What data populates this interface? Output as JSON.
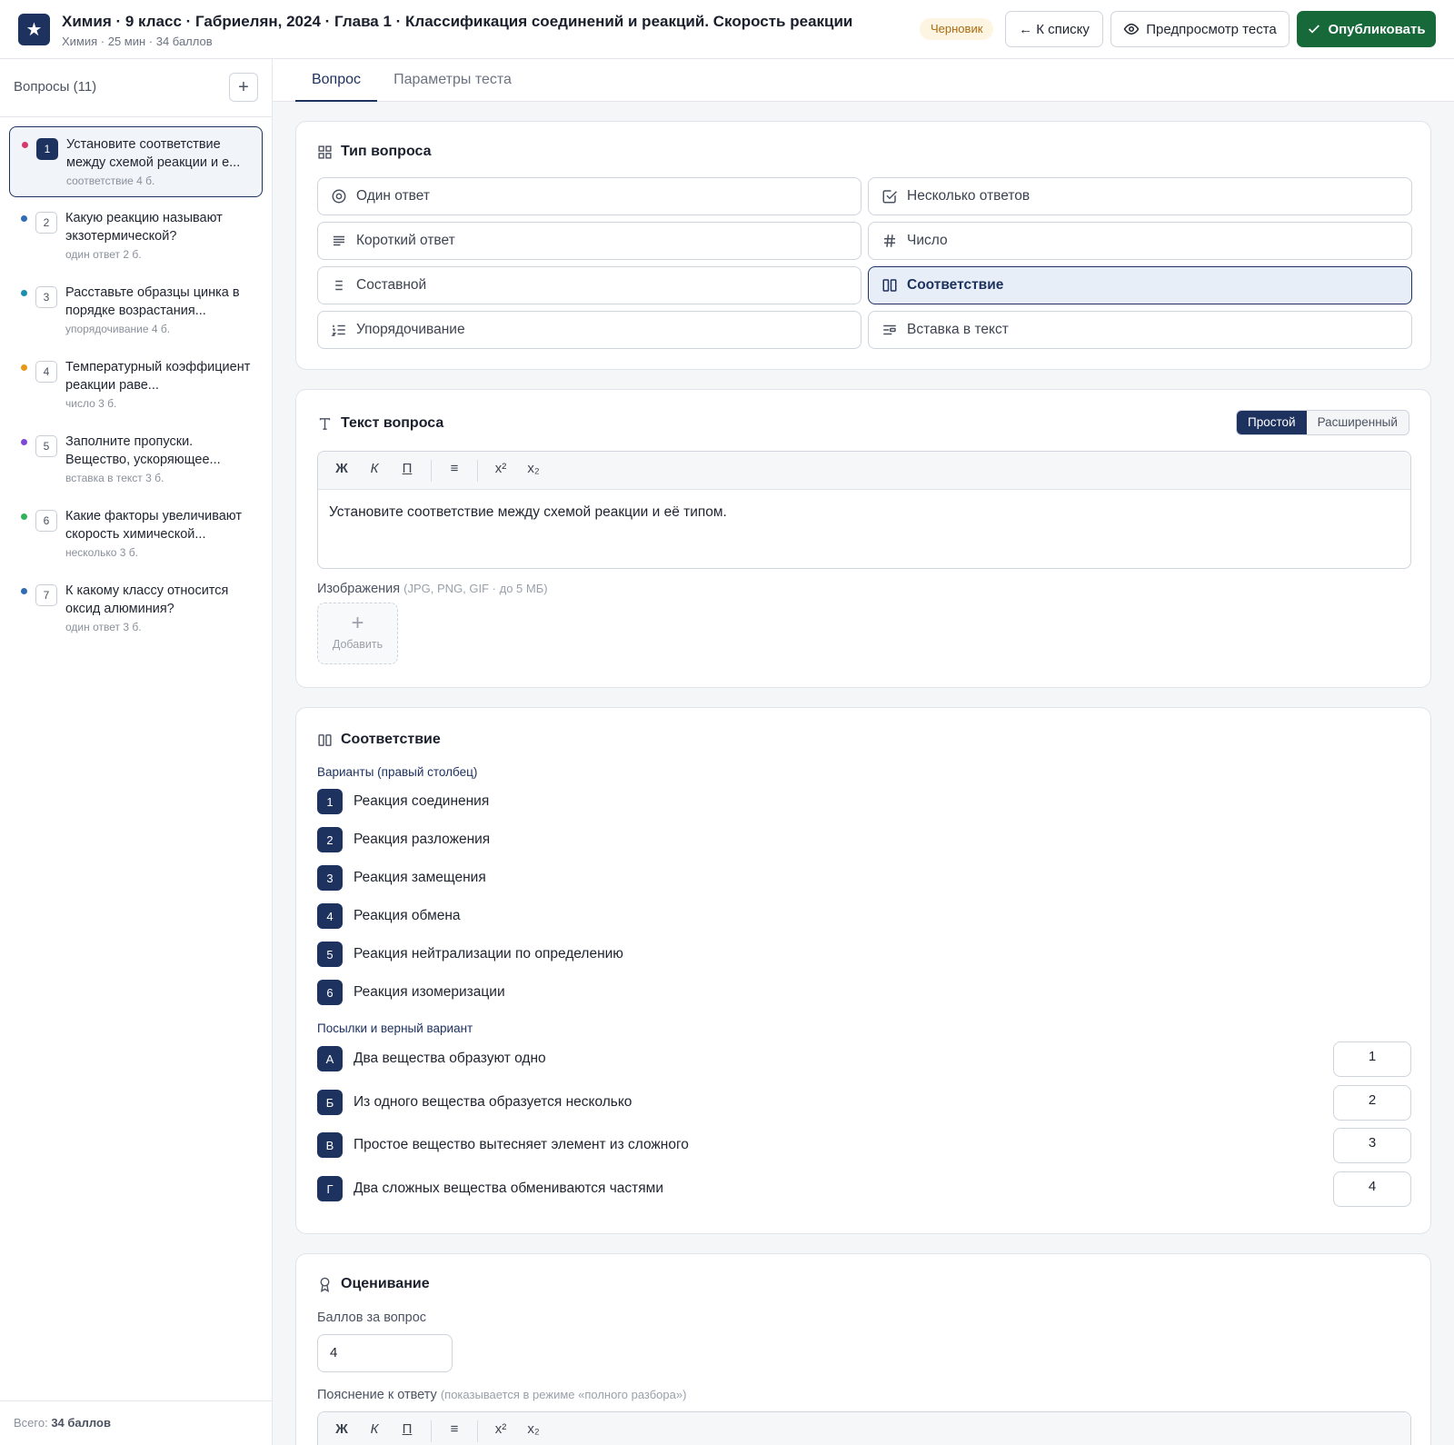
{
  "header": {
    "title": "Химия · 9 класс · Габриелян, 2024 · Глава 1 · Классификация соединений и реакций. Скорость реакции",
    "subtitle": "Химия · 25 мин · 34 баллов",
    "status": "Черновик",
    "back_label": "← К списку",
    "preview_label": "Предпросмотр теста",
    "publish_label": "Опубликовать"
  },
  "sidebar": {
    "title": "Вопросы (11)",
    "add_icon": "+",
    "questions": [
      {
        "num": "1",
        "text": "Установите соответствие между схемой реакции и е...",
        "meta": "соответствие  4 б.",
        "color": "#d63a6a"
      },
      {
        "num": "2",
        "text": "Какую реакцию называют экзотермической?",
        "meta": "один ответ  2 б.",
        "color": "#2e6db4"
      },
      {
        "num": "3",
        "text": "Расставьте образцы цинка в порядке возрастания...",
        "meta": "упорядочивание  4 б.",
        "color": "#1c8fb0"
      },
      {
        "num": "4",
        "text": "Температурный коэффициент реакции раве...",
        "meta": "число  3 б.",
        "color": "#e49a18"
      },
      {
        "num": "5",
        "text": "Заполните пропуски. Вещество, ускоряющее...",
        "meta": "вставка в текст  3 б.",
        "color": "#7c4ad6"
      },
      {
        "num": "6",
        "text": "Какие факторы увеличивают скорость химической...",
        "meta": "несколько  3 б.",
        "color": "#2fb35a"
      },
      {
        "num": "7",
        "text": "К какому классу относится оксид алюминия?",
        "meta": "один ответ  3 б.",
        "color": "#2e6db4"
      }
    ],
    "total_prefix": "Всего:",
    "total_value": "34 баллов"
  },
  "tabs": [
    "Вопрос",
    "Параметры теста"
  ],
  "question_type": {
    "title": "Тип вопроса",
    "options": [
      {
        "label": "Один ответ",
        "icon": "radio-icon"
      },
      {
        "label": "Несколько ответов",
        "icon": "checkbox-icon"
      },
      {
        "label": "Короткий ответ",
        "icon": "text-lines-icon"
      },
      {
        "label": "Число",
        "icon": "hash-icon"
      },
      {
        "label": "Составной",
        "icon": "list-icon"
      },
      {
        "label": "Соответствие",
        "icon": "columns-icon"
      },
      {
        "label": "Упорядочивание",
        "icon": "ordered-list-icon"
      },
      {
        "label": "Вставка в текст",
        "icon": "insert-text-icon"
      }
    ],
    "selected": "Соответствие"
  },
  "question_text": {
    "title": "Текст вопроса",
    "mode_simple": "Простой",
    "mode_advanced": "Расширенный",
    "toolbar": {
      "bold": "Ж",
      "italic": "К",
      "underline": "П",
      "list": "≡",
      "sup": "x²",
      "sub": "x₂"
    },
    "content": "Установите соответствие между схемой реакции и её типом.",
    "images_label": "Изображения",
    "images_hint": "(JPG, PNG, GIF · до 5 МБ)",
    "add_image": "Добавить"
  },
  "matching": {
    "title": "Соответствие",
    "options_label": "Варианты (правый столбец)",
    "options": [
      {
        "num": "1",
        "text": "Реакция соединения"
      },
      {
        "num": "2",
        "text": "Реакция разложения"
      },
      {
        "num": "3",
        "text": "Реакция замещения"
      },
      {
        "num": "4",
        "text": "Реакция обмена"
      },
      {
        "num": "5",
        "text": "Реакция нейтрализации по определению"
      },
      {
        "num": "6",
        "text": "Реакция изомеризации"
      }
    ],
    "premises_label": "Посылки и верный вариант",
    "premises": [
      {
        "letter": "А",
        "text": "Два вещества образуют одно",
        "answer": "1"
      },
      {
        "letter": "Б",
        "text": "Из одного вещества образуется несколько",
        "answer": "2"
      },
      {
        "letter": "В",
        "text": "Простое вещество вытесняет элемент из сложного",
        "answer": "3"
      },
      {
        "letter": "Г",
        "text": "Два сложных вещества обмениваются частями",
        "answer": "4"
      }
    ]
  },
  "grading": {
    "title": "Оценивание",
    "points_label": "Баллов за вопрос",
    "points_value": "4",
    "explanation_label": "Пояснение к ответу",
    "explanation_hint": "(показывается в режиме «полного разбора»)"
  }
}
